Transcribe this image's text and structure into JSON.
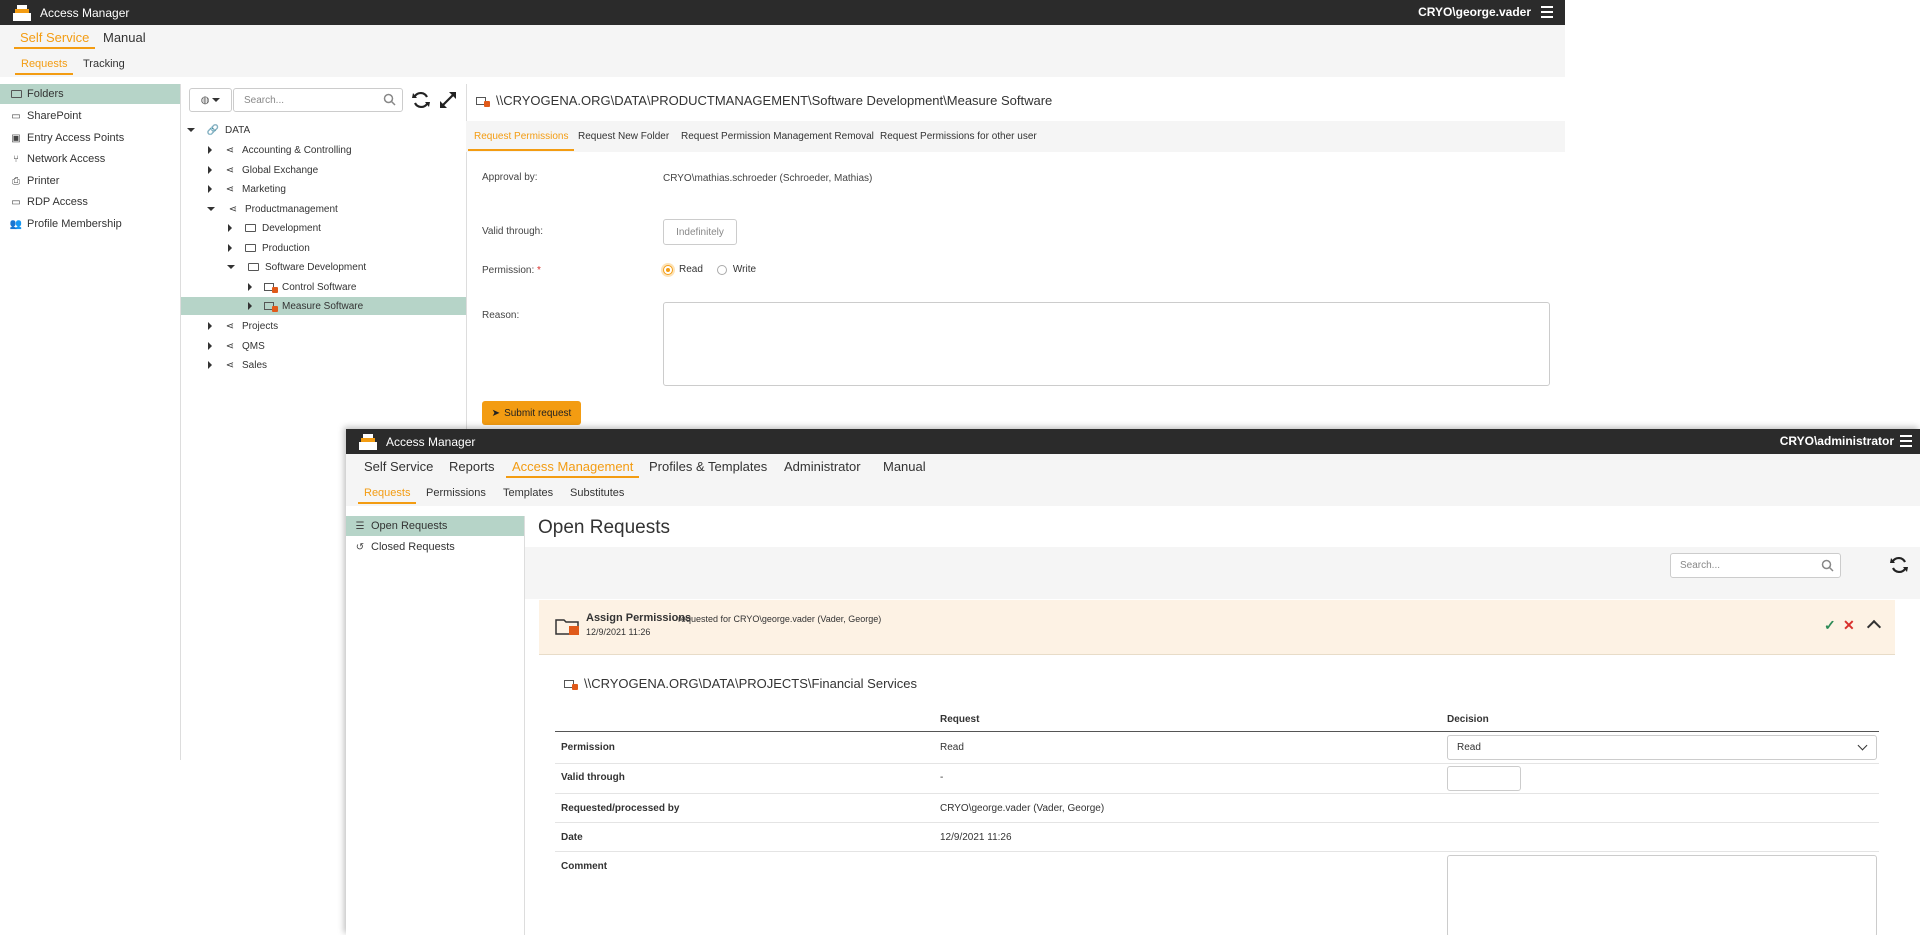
{
  "window1": {
    "app_title": "Access Manager",
    "user": "CRYO\\george.vader",
    "nav": [
      "Self Service",
      "Manual"
    ],
    "subnav": [
      "Requests",
      "Tracking"
    ],
    "sidebar": [
      "Folders",
      "SharePoint",
      "Entry Access Points",
      "Network Access",
      "Printer",
      "RDP Access",
      "Profile Membership"
    ],
    "search_placeholder": "Search...",
    "tree": {
      "root": "DATA",
      "nodes": [
        "Accounting & Controlling",
        "Global Exchange",
        "Marketing",
        "Productmanagement",
        "Development",
        "Production",
        "Software Development",
        "Control Software",
        "Measure Software",
        "Projects",
        "QMS",
        "Sales"
      ]
    },
    "path": "\\\\CRYOGENA.ORG\\DATA\\PRODUCTMANAGEMENT\\Software Development\\Measure Software",
    "tabs": [
      "Request Permissions",
      "Request New Folder",
      "Request Permission Management Removal",
      "Request Permissions for other user"
    ],
    "form": {
      "approval_label": "Approval by:",
      "approval_value": "CRYO\\mathias.schroeder (Schroeder, Mathias)",
      "valid_label": "Valid through:",
      "valid_value": "Indefinitely",
      "permission_label": "Permission:",
      "required_mark": "*",
      "read": "Read",
      "write": "Write",
      "reason_label": "Reason:",
      "submit": "Submit request"
    }
  },
  "window2": {
    "app_title": "Access Manager",
    "user": "CRYO\\administrator",
    "nav": [
      "Self Service",
      "Reports",
      "Access Management",
      "Profiles & Templates",
      "Administrator",
      "Manual"
    ],
    "subnav": [
      "Requests",
      "Permissions",
      "Templates",
      "Substitutes"
    ],
    "sidebar": [
      "Open Requests",
      "Closed Requests"
    ],
    "page_title": "Open Requests",
    "search_placeholder": "Search...",
    "request": {
      "title": "Assign Permissions",
      "requested_for": "requested for CRYO\\george.vader (Vader, George)",
      "date": "12/9/2021 11:26",
      "path": "\\\\CRYOGENA.ORG\\DATA\\PROJECTS\\Financial Services"
    },
    "table": {
      "col_request": "Request",
      "col_decision": "Decision",
      "rows": [
        {
          "label": "Permission",
          "request": "Read",
          "decision": "Read"
        },
        {
          "label": "Valid through",
          "request": "-",
          "decision": ""
        },
        {
          "label": "Requested/processed by",
          "request": "CRYO\\george.vader (Vader, George)",
          "decision": ""
        },
        {
          "label": "Date",
          "request": "12/9/2021 11:26",
          "decision": ""
        },
        {
          "label": "Comment",
          "request": "",
          "decision": ""
        }
      ]
    }
  },
  "colors": {
    "accent": "#f39c12",
    "selected": "#b6d4c8",
    "titlebar": "#2b2b2b",
    "approve": "#2e8b57",
    "reject": "#d9302c"
  }
}
